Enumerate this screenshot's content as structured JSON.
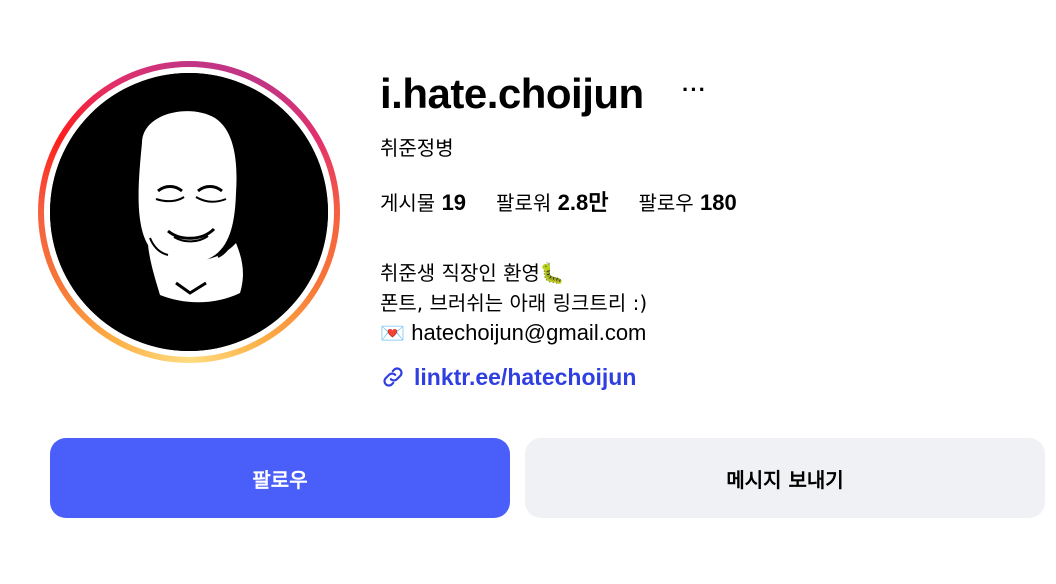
{
  "profile": {
    "username": "i.hate.choijun",
    "more_label": "···",
    "full_name": "취준정병"
  },
  "stats": {
    "posts_label": "게시물",
    "posts_count": "19",
    "followers_label": "팔로워",
    "followers_count": "2.8만",
    "following_label": "팔로우",
    "following_count": "180"
  },
  "bio": {
    "line1": "취준생 직장인 환영🐛",
    "line2": "폰트, 브러쉬는 아래 링크트리 :)",
    "email_icon": "💌",
    "email": "hatechoijun@gmail.com"
  },
  "link": {
    "icon": "link-icon",
    "text": "linktr.ee/hatechoijun"
  },
  "buttons": {
    "follow": "팔로우",
    "message": "메시지 보내기"
  },
  "colors": {
    "follow_button": "#4a5ef9",
    "message_button": "#eff1f4",
    "link": "#2f3fe0"
  }
}
